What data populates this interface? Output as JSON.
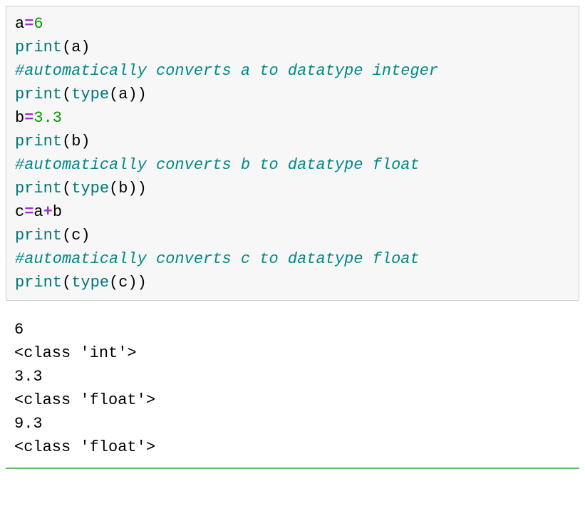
{
  "code": {
    "lines": [
      {
        "tokens": [
          {
            "t": "a",
            "c": "var"
          },
          {
            "t": "=",
            "c": "op"
          },
          {
            "t": "6",
            "c": "num"
          }
        ]
      },
      {
        "tokens": [
          {
            "t": "print",
            "c": "func"
          },
          {
            "t": "(",
            "c": "paren"
          },
          {
            "t": "a",
            "c": "var"
          },
          {
            "t": ")",
            "c": "paren"
          }
        ]
      },
      {
        "tokens": [
          {
            "t": "#automatically converts a to datatype integer",
            "c": "comment"
          }
        ]
      },
      {
        "tokens": [
          {
            "t": "print",
            "c": "func"
          },
          {
            "t": "(",
            "c": "paren"
          },
          {
            "t": "type",
            "c": "func"
          },
          {
            "t": "(",
            "c": "paren"
          },
          {
            "t": "a",
            "c": "var"
          },
          {
            "t": ")",
            "c": "paren"
          },
          {
            "t": ")",
            "c": "paren"
          }
        ]
      },
      {
        "tokens": [
          {
            "t": "b",
            "c": "var"
          },
          {
            "t": "=",
            "c": "op"
          },
          {
            "t": "3.3",
            "c": "num"
          }
        ]
      },
      {
        "tokens": [
          {
            "t": "print",
            "c": "func"
          },
          {
            "t": "(",
            "c": "paren"
          },
          {
            "t": "b",
            "c": "var"
          },
          {
            "t": ")",
            "c": "paren"
          }
        ]
      },
      {
        "tokens": [
          {
            "t": "#automatically converts b to datatype float",
            "c": "comment"
          }
        ]
      },
      {
        "tokens": [
          {
            "t": "print",
            "c": "func"
          },
          {
            "t": "(",
            "c": "paren"
          },
          {
            "t": "type",
            "c": "func"
          },
          {
            "t": "(",
            "c": "paren"
          },
          {
            "t": "b",
            "c": "var"
          },
          {
            "t": ")",
            "c": "paren"
          },
          {
            "t": ")",
            "c": "paren"
          }
        ]
      },
      {
        "tokens": [
          {
            "t": "c",
            "c": "var"
          },
          {
            "t": "=",
            "c": "op"
          },
          {
            "t": "a",
            "c": "var"
          },
          {
            "t": "+",
            "c": "op"
          },
          {
            "t": "b",
            "c": "var"
          }
        ]
      },
      {
        "tokens": [
          {
            "t": "print",
            "c": "func"
          },
          {
            "t": "(",
            "c": "paren"
          },
          {
            "t": "c",
            "c": "var"
          },
          {
            "t": ")",
            "c": "paren"
          }
        ]
      },
      {
        "tokens": [
          {
            "t": "#automatically converts c to datatype float",
            "c": "comment"
          }
        ]
      },
      {
        "tokens": [
          {
            "t": "print",
            "c": "func"
          },
          {
            "t": "(",
            "c": "paren"
          },
          {
            "t": "type",
            "c": "func"
          },
          {
            "t": "(",
            "c": "paren"
          },
          {
            "t": "c",
            "c": "var"
          },
          {
            "t": ")",
            "c": "paren"
          },
          {
            "t": ")",
            "c": "paren"
          }
        ]
      }
    ]
  },
  "output": {
    "lines": [
      "6",
      "<class 'int'>",
      "3.3",
      "<class 'float'>",
      "9.3",
      "<class 'float'>"
    ]
  }
}
